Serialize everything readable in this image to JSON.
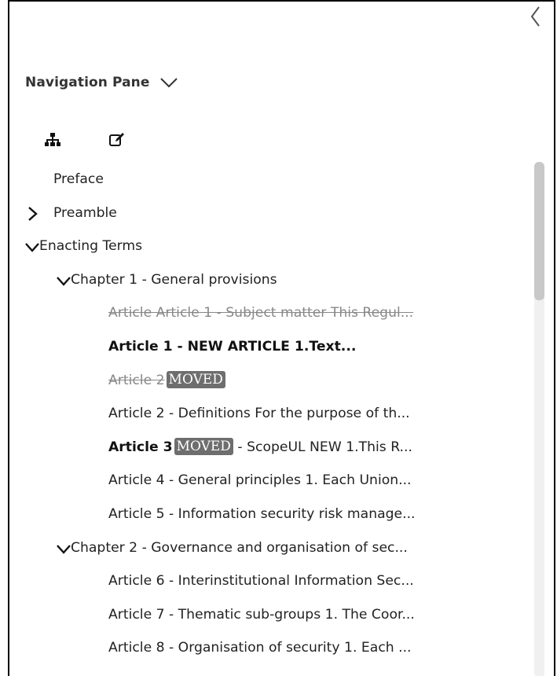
{
  "pane": {
    "title": "Navigation Pane",
    "tools": [
      {
        "icon": "hierarchy-icon"
      },
      {
        "icon": "edit-icon"
      }
    ]
  },
  "tree": [
    {
      "label": "Preface",
      "level": 0,
      "toggle": "none",
      "style": "normal"
    },
    {
      "label": "Preamble",
      "level": 0,
      "toggle": "collapsed",
      "style": "normal"
    },
    {
      "label": "Enacting Terms",
      "level": 0,
      "toggle": "expanded",
      "style": "normal"
    },
    {
      "label": "Chapter 1 - General provisions",
      "level": 1,
      "toggle": "expanded",
      "style": "normal"
    },
    {
      "label": "Article Article 1 - Subject matter This Regul...",
      "level": 2,
      "toggle": "none",
      "style": "strike"
    },
    {
      "label": "Article 1 - NEW ARTICLE 1.Text...",
      "level": 2,
      "toggle": "none",
      "style": "bold"
    },
    {
      "label": "Article 2",
      "badge": "MOVED",
      "level": 2,
      "toggle": "none",
      "style": "strike"
    },
    {
      "label": "Article 2 - Definitions For the purpose of th...",
      "level": 2,
      "toggle": "none",
      "style": "normal"
    },
    {
      "label": "Article 3",
      "badge": "MOVED",
      "suffix": " - ScopeUL NEW 1.This R...",
      "level": 2,
      "toggle": "none",
      "style": "bold"
    },
    {
      "label": "Article 4 - General principles  1. Each Union...",
      "level": 2,
      "toggle": "none",
      "style": "normal"
    },
    {
      "label": "Article 5 - Information security risk manage...",
      "level": 2,
      "toggle": "none",
      "style": "normal"
    },
    {
      "label": "Chapter 2 - Governance and organisation of sec...",
      "level": 1,
      "toggle": "expanded",
      "style": "normal"
    },
    {
      "label": "Article 6 - Interinstitutional Information Sec...",
      "level": 2,
      "toggle": "none",
      "style": "normal"
    },
    {
      "label": "Article 7 - Thematic sub-groups 1. The Coor...",
      "level": 2,
      "toggle": "none",
      "style": "normal"
    },
    {
      "label": "Article 8 - Organisation of security 1. Each ...",
      "level": 2,
      "toggle": "none",
      "style": "normal"
    }
  ],
  "scrollbar": {
    "position": 0,
    "visible_fraction": 0.27
  },
  "colors": {
    "strike_text": "#888888",
    "badge_bg": "#6e6e6e",
    "badge_text": "#ffffff"
  }
}
